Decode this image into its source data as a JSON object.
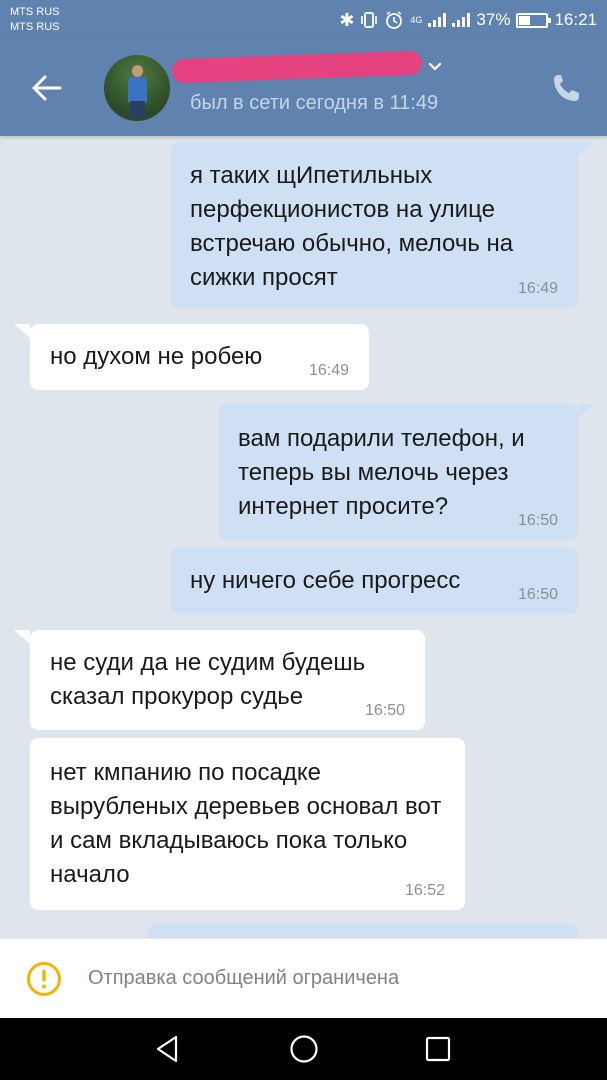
{
  "status_bar": {
    "carrier_1": "MTS RUS",
    "carrier_2": "MTS RUS",
    "network": "4G",
    "battery": "37%",
    "time": "16:21"
  },
  "header": {
    "contact_name": "[redacted]",
    "last_seen": "был в сети сегодня в 11:49",
    "icons": [
      "back-arrow-icon",
      "avatar",
      "chevron-down-icon",
      "phone-icon"
    ]
  },
  "messages": [
    {
      "direction": "out",
      "text": "я таких щИпетильных перфекционистов на улице встречаю обычно, мелочь на сижки просят",
      "time": "16:49"
    },
    {
      "direction": "in",
      "text": "но духом не робею",
      "time": "16:49"
    },
    {
      "direction": "out",
      "text": "вам подарили телефон, и теперь вы мелочь через интернет просите?",
      "time": "16:50"
    },
    {
      "direction": "out",
      "text": "ну ничего себе прогресс",
      "time": "16:50"
    },
    {
      "direction": "in",
      "text": "не суди да не судим будешь сказал прокурор судье",
      "time": "16:50"
    },
    {
      "direction": "in",
      "text": "нет кмпанию по посадке вырубленых деревьев основал вот и сам вкладываюсь пока только начало",
      "time": "16:52"
    }
  ],
  "composer": {
    "restricted_text": "Отправка сообщений ограничена",
    "icon": "warning-icon"
  },
  "colors": {
    "header": "#5f82ae",
    "outgoing_bubble": "#cfe0f5",
    "incoming_bubble": "#ffffff",
    "chat_background": "#dfe5ec",
    "warning": "#f2b400"
  }
}
